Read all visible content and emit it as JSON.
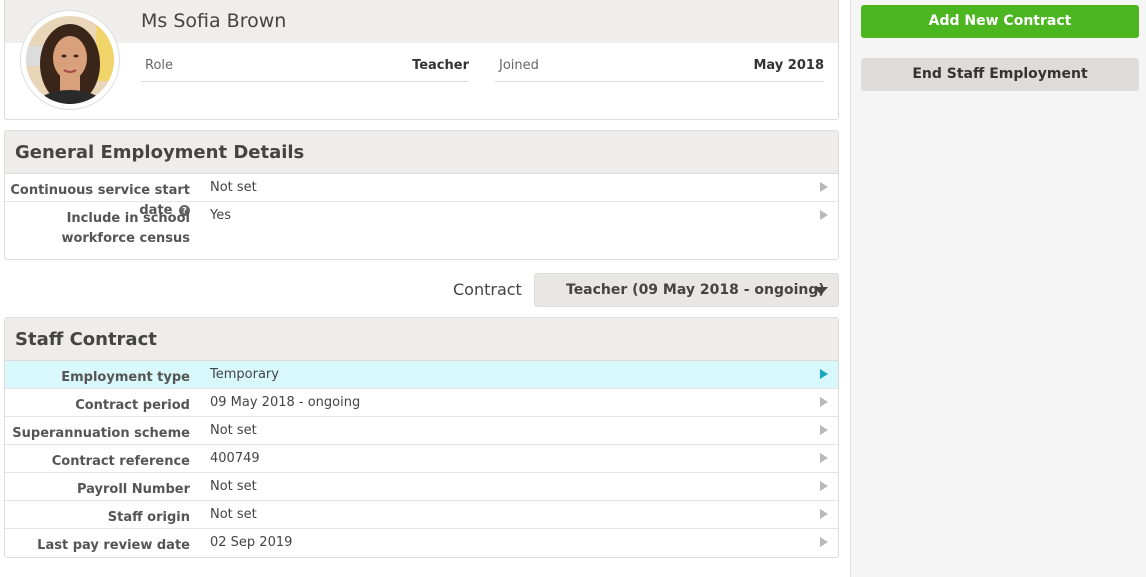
{
  "profile": {
    "name": "Ms Sofia Brown",
    "role_label": "Role",
    "role_value": "Teacher",
    "joined_label": "Joined",
    "joined_value": "May 2018"
  },
  "general": {
    "title": "General Employment Details",
    "rows": [
      {
        "label": "Continuous service start date",
        "value": "Not set"
      },
      {
        "label": "Include in school workforce census",
        "value": "Yes"
      }
    ]
  },
  "contract_selector": {
    "label": "Contract",
    "value": "Teacher (09 May 2018 - ongoing)"
  },
  "staff_contract": {
    "title": "Staff Contract",
    "rows": [
      {
        "label": "Employment type",
        "value": "Temporary"
      },
      {
        "label": "Contract period",
        "value": "09 May 2018 - ongoing"
      },
      {
        "label": "Superannuation scheme",
        "value": "Not set"
      },
      {
        "label": "Contract reference",
        "value": "400749"
      },
      {
        "label": "Payroll Number",
        "value": "Not set"
      },
      {
        "label": "Staff origin",
        "value": "Not set"
      },
      {
        "label": "Last pay review date",
        "value": "02 Sep 2019"
      }
    ]
  },
  "actions": {
    "add_contract": "Add New Contract",
    "end_employment": "End Staff Employment"
  },
  "colors": {
    "primary_green": "#4cb621",
    "active_row": "#d8f8fb",
    "active_arrow": "#1aa9bf"
  },
  "icons": {
    "help": "help-icon",
    "row_arrow": "chevron-right-icon",
    "dropdown": "caret-down-icon"
  }
}
